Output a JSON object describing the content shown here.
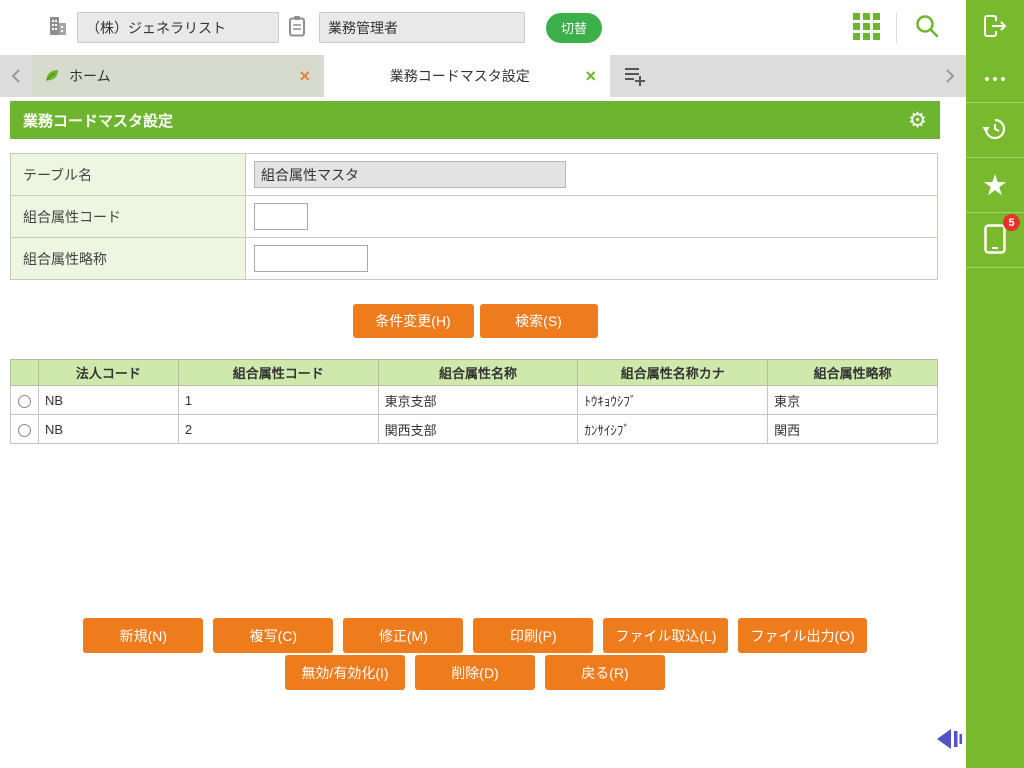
{
  "header": {
    "company_value": "（株）ジェネラリスト",
    "role_value": "業務管理者",
    "switch_label": "切替"
  },
  "tabbar": {
    "home_label": "ホーム",
    "active_label": "業務コードマスタ設定"
  },
  "page": {
    "title": "業務コードマスタ設定"
  },
  "form": {
    "table_name_label": "テーブル名",
    "table_name_value": "組合属性マスタ",
    "code_label": "組合属性コード",
    "abbr_label": "組合属性略称"
  },
  "search": {
    "change_label": "条件変更(H)",
    "search_label": "検索(S)"
  },
  "result_table": {
    "headers": [
      "法人コード",
      "組合属性コード",
      "組合属性名称",
      "組合属性名称カナ",
      "組合属性略称"
    ],
    "rows": [
      {
        "cells": [
          "NB",
          "1",
          "東京支部",
          "ﾄｳｷｮｳｼﾌﾞ",
          "東京"
        ]
      },
      {
        "cells": [
          "NB",
          "2",
          "関西支部",
          "ｶﾝｻｲｼﾌﾞ",
          "関西"
        ]
      }
    ]
  },
  "actions": {
    "new": "新規(N)",
    "copy": "複写(C)",
    "edit": "修正(M)",
    "print": "印刷(P)",
    "file_import": "ファイル取込(L)",
    "file_export": "ファイル出力(O)",
    "toggle_enable": "無効/有効化(I)",
    "delete": "削除(D)",
    "back": "戻る(R)"
  },
  "sidebar": {
    "badge_count": "5"
  },
  "icons": {
    "close_glyph": "×",
    "star_glyph": "★",
    "gear_glyph": "⚙"
  },
  "colors": {
    "theme_green": "#6db52e",
    "sidebar_green": "#79b92e",
    "button_orange": "#ee7b1c",
    "table_header_green": "#cfe9ad",
    "label_green": "#edf6e1",
    "badge_red": "#e5332a",
    "switch_green": "#3bb04a",
    "back_indigo": "#5252cc"
  }
}
